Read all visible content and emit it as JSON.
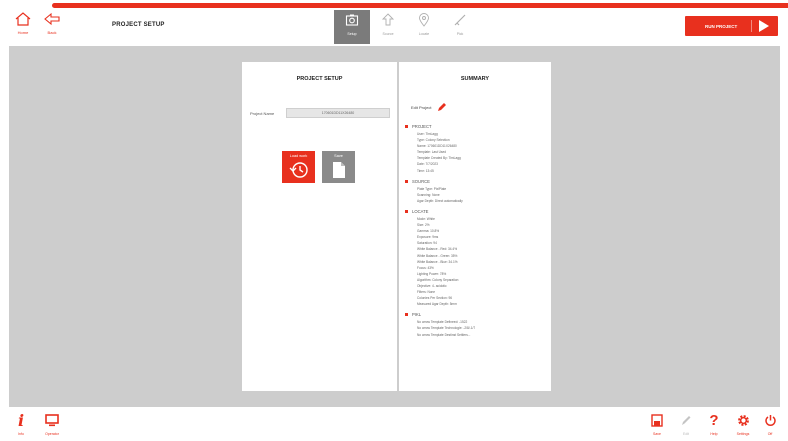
{
  "topbar": {
    "home_label": "Home",
    "back_label": "Back",
    "title": "PROJECT SETUP",
    "steps": [
      {
        "label": "Setup",
        "icon": "camera-icon",
        "active": true
      },
      {
        "label": "Source",
        "icon": "upload-arrow-icon",
        "active": false
      },
      {
        "label": "Locate",
        "icon": "location-pin-icon",
        "active": false
      },
      {
        "label": "Pick",
        "icon": "checkmark-icon",
        "active": false
      }
    ],
    "run_label": "RUN PROJECT"
  },
  "left_panel": {
    "title": "PROJECT SETUP",
    "project_name_label": "Project Name",
    "project_name_value": "170601DD11X26480",
    "load_label": "Load work",
    "save_label": "Save"
  },
  "summary": {
    "title": "SUMMARY",
    "edit_label": "Edit Project",
    "sections": [
      {
        "head": "PROJECT",
        "lines": [
          "User: TimLagg",
          "Type: Colony Selection",
          "Name: 170601DD11X26480",
          "Template: Last Used",
          "Template Created By: TimLagg",
          "Date: 7/7/2023",
          "Time: 13:45"
        ]
      },
      {
        "head": "SOURCE",
        "lines": [
          "Plate Type: PixlPlate",
          "Scanning: None",
          "Agar Depth: Direct automatically"
        ]
      },
      {
        "head": "LOCATE",
        "lines": [
          "Mode: White",
          "Size: 2%",
          "Gamma: 10.8%",
          "Exposure: 9ms",
          "Saturation: 94",
          "White Balance - Red: 34.4%",
          "White Balance - Green: 35%",
          "White Balance - Blue: 34.1%",
          "Focus: 43%",
          "Lighting Power: 78%",
          "Algorithm: Colony Separation",
          "Objective: 4- acidotic",
          "Filters: None",
          "Colonies Per Section: 96",
          "Measured Agar Depth: 5mm"
        ]
      },
      {
        "head": "PIKL",
        "lines": [
          "No arrow Template Defineed: -1522",
          "No arrow Template Technologie: -2/8/-1/7",
          "No arrow Template Destinst Settlers..."
        ]
      }
    ]
  },
  "bottombar": {
    "info_label": "Info",
    "monitor_label": "Operator",
    "save_label": "Save",
    "edit_label": "Edit",
    "help_label": "Help",
    "settings_label": "Settings",
    "power_label": "Off"
  },
  "colors": {
    "accent": "#e8301e",
    "workspace": "#cdcdcd",
    "active_step": "#7b7b7b"
  }
}
